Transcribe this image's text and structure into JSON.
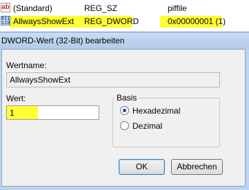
{
  "registry": {
    "rows": [
      {
        "icon": "string-value-icon",
        "name": "(Standard)",
        "type": "REG_SZ",
        "data": "piffile"
      },
      {
        "icon": "binary-value-icon",
        "name": "AllwaysShowExt",
        "type": "REG_DWORD",
        "data": "0x00000001 (1)"
      }
    ]
  },
  "dialog": {
    "title": "DWORD-Wert (32-Bit) bearbeiten",
    "name_label": "Wertname:",
    "name_value": "AllwaysShowExt",
    "value_label": "Wert:",
    "value": "1",
    "basis": {
      "legend": "Basis",
      "options": [
        "Hexadezimal",
        "Dezimal"
      ],
      "selected": "Hexadezimal"
    },
    "ok_label": "OK",
    "cancel_label": "Abbrechen"
  },
  "colors": {
    "highlight": "#ffff33",
    "title_bar": "#bcd4ee"
  }
}
